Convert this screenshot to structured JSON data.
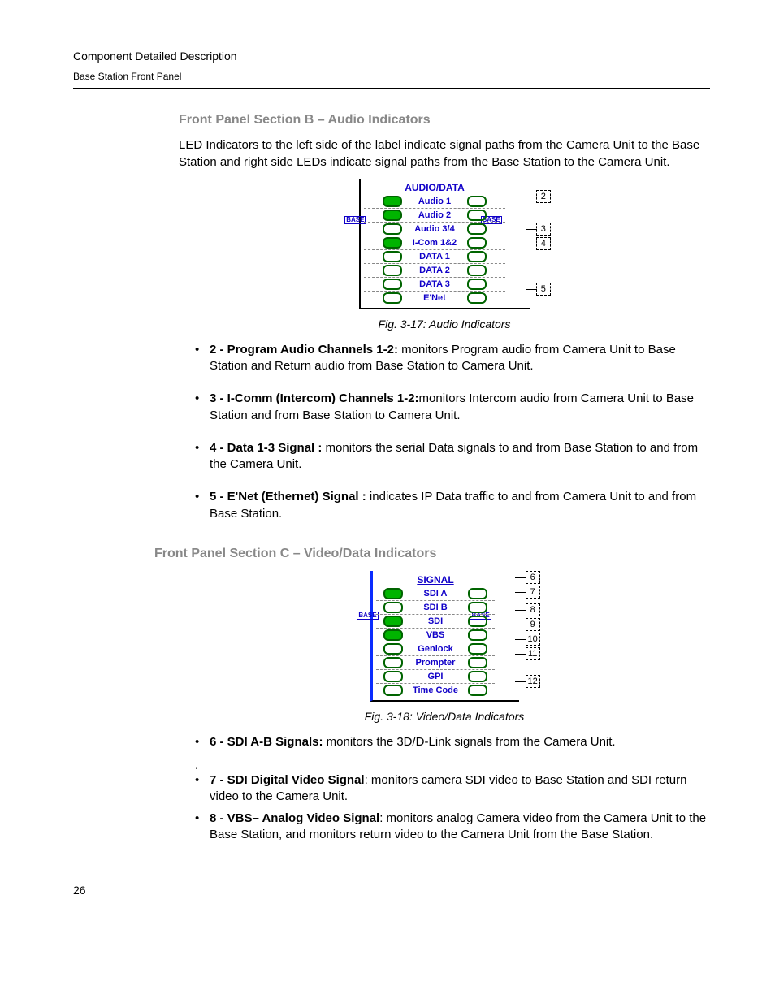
{
  "header": {
    "line1": "Component Detailed Description",
    "line2": "Base Station Front Panel"
  },
  "sectionB": {
    "heading": "Front Panel Section B – Audio Indicators",
    "intro": "LED Indicators to the left side of the label indicate signal paths from the Camera Unit to the Base Station and right side LEDs indicate signal paths from the Base Station to the Camera Unit.",
    "caption": "Fig. 3-17: Audio Indicators",
    "panel": {
      "title": "AUDIO/DATA",
      "rows": [
        "Audio 1",
        "Audio 2",
        "Audio 3/4",
        "I-Com 1&2",
        "DATA 1",
        "DATA 2",
        "DATA 3",
        "E'Net"
      ],
      "callouts": [
        "2",
        "3",
        "4",
        "5"
      ],
      "sideLabel": "BASE"
    },
    "bullets": [
      {
        "lead": "2 - Program Audio Channels 1-2:",
        "rest": " monitors Program audio from Camera Unit to Base Station and Return audio from Base Station to Camera Unit."
      },
      {
        "lead": "3 - I-Comm (Intercom) Channels  1-2:",
        "rest": "monitors Intercom audio from Camera Unit to Base Station and from Base Station to Camera Unit."
      },
      {
        "lead": "4 - Data 1-3 Signal :",
        "rest": " monitors the serial Data signals to and from Base Station to and from the Camera Unit."
      },
      {
        "lead": "5 - E'Net (Ethernet) Signal :",
        "rest": " indicates IP Data traffic to and from Camera Unit to and from Base Station."
      }
    ]
  },
  "sectionC": {
    "heading": "Front Panel Section C – Video/Data Indicators",
    "caption": "Fig. 3-18: Video/Data Indicators",
    "panel": {
      "title": "SIGNAL",
      "rows": [
        "SDI A",
        "SDI B",
        "SDI",
        "VBS",
        "Genlock",
        "Prompter",
        "GPI",
        "Time Code"
      ],
      "callouts": [
        "6",
        "7",
        "8",
        "9",
        "10",
        "11",
        "12"
      ],
      "sideLabel": "BASE"
    },
    "bullets": [
      {
        "lead": "6 - SDI A-B Signals:",
        "rest": " monitors the 3D/D-Link signals from the Camera Unit."
      },
      {
        "lead": ".",
        "rest": "",
        "plain": true
      },
      {
        "lead": "7 - SDI Digital Video Signal",
        "rest": ": monitors camera SDI video to Base Station and SDI return video to the Camera Unit."
      },
      {
        "lead": "8 - VBS– Analog Video Signal",
        "rest": ": monitors analog Camera video from the Camera Unit to the Base Station, and monitors return video to the Camera Unit from the Base Station."
      }
    ]
  },
  "pageNumber": "26"
}
